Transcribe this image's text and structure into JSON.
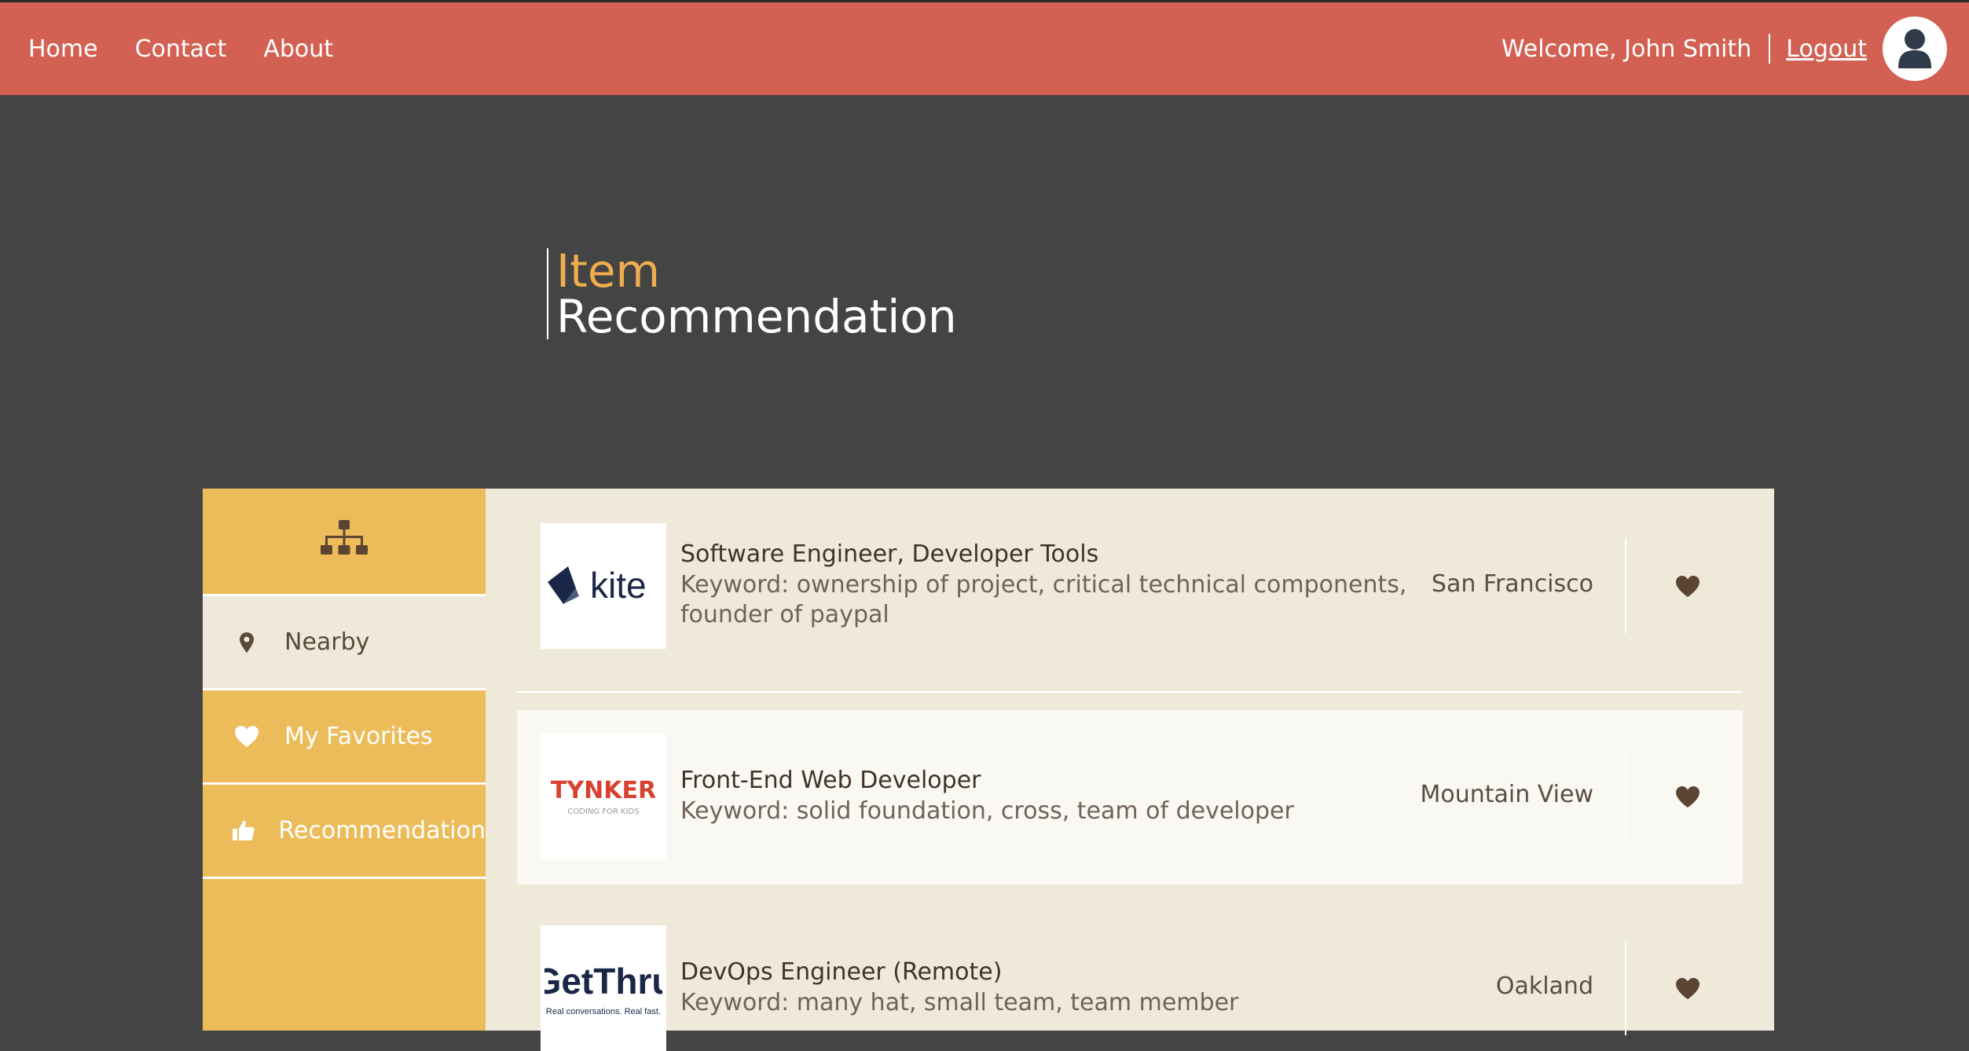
{
  "nav": {
    "items": [
      {
        "label": "Home"
      },
      {
        "label": "Contact"
      },
      {
        "label": "About"
      }
    ]
  },
  "user": {
    "welcome": "Welcome, John Smith",
    "logout": "Logout",
    "avatar_icon": "user-icon"
  },
  "hero": {
    "line1": "Item",
    "line2": "Recommendation"
  },
  "sidebar": {
    "header_icon": "sitemap-icon",
    "items": [
      {
        "label": "Nearby",
        "icon": "map-marker-icon",
        "active": true
      },
      {
        "label": "My Favorites",
        "icon": "heart-icon",
        "active": false
      },
      {
        "label": "Recommendation",
        "icon": "thumbs-up-icon",
        "active": false
      }
    ]
  },
  "jobs": [
    {
      "title": "Software Engineer, Developer Tools",
      "keywords": "Keyword: ownership of project, critical technical components, founder of paypal",
      "location": "San Francisco",
      "logo_text": "kite"
    },
    {
      "title": "Front-End Web Developer",
      "keywords": "Keyword: solid foundation, cross, team of developer",
      "location": "Mountain View",
      "logo_text": "TYNKER",
      "logo_sub": "CODING FOR KIDS"
    },
    {
      "title": "DevOps Engineer (Remote)",
      "keywords": "Keyword: many hat, small team, team member",
      "location": "Oakland",
      "logo_text": "GetThru",
      "logo_sub": "Real conversations. Real fast."
    }
  ],
  "colors": {
    "topbar": "#d26153",
    "background": "#444444",
    "sidebar": "#ebbc59",
    "panel": "#efe9da",
    "accent": "#f0ad4e",
    "heart": "#5c4433"
  }
}
